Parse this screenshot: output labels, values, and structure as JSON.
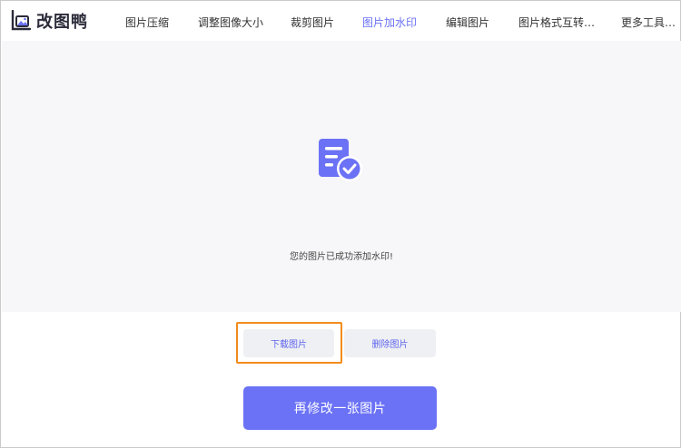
{
  "brand": {
    "name": "改图鸭",
    "color": "#6b72f5"
  },
  "nav": {
    "items": [
      {
        "label": "图片压缩"
      },
      {
        "label": "调整图像大小"
      },
      {
        "label": "裁剪图片"
      },
      {
        "label": "图片加水印",
        "active": true
      },
      {
        "label": "编辑图片"
      },
      {
        "label": "图片格式互转…"
      },
      {
        "label": "更多工具…"
      }
    ]
  },
  "result": {
    "icon": "document-check-icon",
    "message": "您的图片已成功添加水印!"
  },
  "actions": {
    "download_label": "下载图片",
    "delete_label": "删除图片",
    "edit_another_label": "再修改一张图片"
  },
  "colors": {
    "accent": "#6b72f5",
    "highlight": "#f28c1c",
    "panel_bg": "#f7f7f9",
    "secondary_btn_bg": "#eff0f3"
  }
}
